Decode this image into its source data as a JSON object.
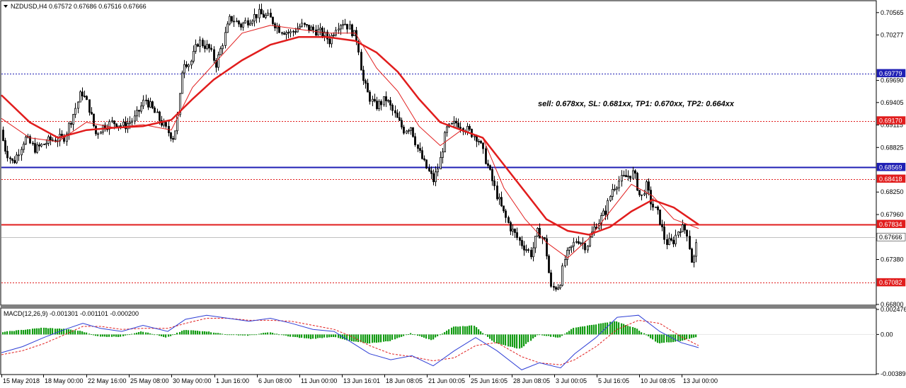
{
  "main_info": "NZDUSD,H4  0.67572 0.67686 0.67516 0.67666",
  "macd_info": "MACD(12,26,9) -0.001301 -0.001101 -0.000200",
  "annotation": "sell: 0.678xx, SL: 0.681xx, TP1: 0.670xx, TP2: 0.664xx",
  "colors": {
    "candle": "#000000",
    "ma_thick": "#e11d1d",
    "ma_thin": "#e11d1d",
    "blue_level": "#1f1fb4",
    "red_level": "#e11d1d",
    "macd_hist": "#129b12",
    "macd_line": "#2f3fd6",
    "macd_signal": "#e11d1d",
    "current_price": "#c0c0c0"
  },
  "chart_data": [
    {
      "type": "candlestick",
      "symbol": "NZDUSD",
      "timeframe": "H4",
      "ylim": [
        0.668,
        0.707
      ],
      "y_ticks": [
        "0.70565",
        "0.70277",
        "0.69690",
        "0.69405",
        "0.69115",
        "0.68825",
        "0.68250",
        "0.67960",
        "0.67380",
        "0.66800"
      ],
      "x_ticks": [
        "15 May 2018",
        "18 May 00:00",
        "22 May 16:00",
        "25 May 08:00",
        "30 May 00:00",
        "1 Jun 16:00",
        "6 Jun 08:00",
        "11 Jun 00:00",
        "13 Jun 16:01",
        "18 Jun 08:05",
        "21 Jun 00:05",
        "25 Jun 16:05",
        "28 Jun 08:05",
        "3 Jul 00:05",
        "5 Jul 16:05",
        "10 Jul 08:05",
        "13 Jul 00:00"
      ],
      "price_path": [
        [
          0,
          0.6905
        ],
        [
          8,
          0.6878
        ],
        [
          18,
          0.6862
        ],
        [
          35,
          0.6895
        ],
        [
          50,
          0.688
        ],
        [
          70,
          0.6892
        ],
        [
          90,
          0.6895
        ],
        [
          105,
          0.693
        ],
        [
          115,
          0.6955
        ],
        [
          125,
          0.6935
        ],
        [
          135,
          0.69
        ],
        [
          145,
          0.691
        ],
        [
          160,
          0.6915
        ],
        [
          175,
          0.691
        ],
        [
          190,
          0.692
        ],
        [
          205,
          0.6945
        ],
        [
          220,
          0.6925
        ],
        [
          235,
          0.6905
        ],
        [
          245,
          0.6895
        ],
        [
          252,
          0.693
        ],
        [
          258,
          0.6995
        ],
        [
          268,
          0.699
        ],
        [
          280,
          0.702
        ],
        [
          295,
          0.701
        ],
        [
          305,
          0.699
        ],
        [
          315,
          0.702
        ],
        [
          325,
          0.705
        ],
        [
          340,
          0.704
        ],
        [
          355,
          0.705
        ],
        [
          365,
          0.7055
        ],
        [
          380,
          0.705
        ],
        [
          395,
          0.7035
        ],
        [
          410,
          0.703
        ],
        [
          425,
          0.704
        ],
        [
          440,
          0.7035
        ],
        [
          455,
          0.703
        ],
        [
          465,
          0.702
        ],
        [
          475,
          0.704
        ],
        [
          485,
          0.7045
        ],
        [
          495,
          0.7035
        ],
        [
          505,
          0.702
        ],
        [
          512,
          0.697
        ],
        [
          520,
          0.695
        ],
        [
          530,
          0.6935
        ],
        [
          545,
          0.6945
        ],
        [
          560,
          0.692
        ],
        [
          570,
          0.6905
        ],
        [
          580,
          0.691
        ],
        [
          590,
          0.688
        ],
        [
          600,
          0.686
        ],
        [
          612,
          0.684
        ],
        [
          620,
          0.686
        ],
        [
          630,
          0.6905
        ],
        [
          645,
          0.6915
        ],
        [
          660,
          0.6905
        ],
        [
          675,
          0.6895
        ],
        [
          690,
          0.6855
        ],
        [
          700,
          0.6825
        ],
        [
          710,
          0.68
        ],
        [
          720,
          0.678
        ],
        [
          735,
          0.676
        ],
        [
          750,
          0.6745
        ],
        [
          760,
          0.6775
        ],
        [
          770,
          0.676
        ],
        [
          778,
          0.67
        ],
        [
          790,
          0.6705
        ],
        [
          798,
          0.674
        ],
        [
          805,
          0.675
        ],
        [
          815,
          0.6765
        ],
        [
          828,
          0.6755
        ],
        [
          840,
          0.678
        ],
        [
          855,
          0.68
        ],
        [
          865,
          0.683
        ],
        [
          875,
          0.684
        ],
        [
          885,
          0.6845
        ],
        [
          895,
          0.685
        ],
        [
          905,
          0.6815
        ],
        [
          912,
          0.6835
        ],
        [
          920,
          0.681
        ],
        [
          930,
          0.6795
        ],
        [
          940,
          0.676
        ],
        [
          950,
          0.676
        ],
        [
          960,
          0.678
        ],
        [
          970,
          0.6775
        ],
        [
          978,
          0.673
        ],
        [
          985,
          0.6765
        ]
      ],
      "moving_averages": {
        "thick": [
          [
            0,
            0.695
          ],
          [
            40,
            0.6915
          ],
          [
            80,
            0.6895
          ],
          [
            120,
            0.6905
          ],
          [
            160,
            0.6908
          ],
          [
            200,
            0.691
          ],
          [
            240,
            0.6918
          ],
          [
            270,
            0.6945
          ],
          [
            300,
            0.697
          ],
          [
            340,
            0.6995
          ],
          [
            380,
            0.7015
          ],
          [
            420,
            0.7025
          ],
          [
            460,
            0.7025
          ],
          [
            500,
            0.702
          ],
          [
            530,
            0.7005
          ],
          [
            560,
            0.698
          ],
          [
            590,
            0.6945
          ],
          [
            620,
            0.6915
          ],
          [
            650,
            0.6905
          ],
          [
            680,
            0.6895
          ],
          [
            710,
            0.686
          ],
          [
            740,
            0.6825
          ],
          [
            770,
            0.679
          ],
          [
            800,
            0.6775
          ],
          [
            830,
            0.677
          ],
          [
            860,
            0.678
          ],
          [
            890,
            0.68
          ],
          [
            920,
            0.6815
          ],
          [
            950,
            0.6805
          ],
          [
            985,
            0.6783
          ]
        ],
        "thin": [
          [
            0,
            0.692
          ],
          [
            40,
            0.6895
          ],
          [
            80,
            0.689
          ],
          [
            120,
            0.6915
          ],
          [
            160,
            0.6908
          ],
          [
            200,
            0.6912
          ],
          [
            240,
            0.6905
          ],
          [
            270,
            0.696
          ],
          [
            300,
            0.699
          ],
          [
            340,
            0.703
          ],
          [
            380,
            0.704
          ],
          [
            420,
            0.7035
          ],
          [
            460,
            0.703
          ],
          [
            500,
            0.703
          ],
          [
            530,
            0.6985
          ],
          [
            560,
            0.6955
          ],
          [
            590,
            0.691
          ],
          [
            620,
            0.6885
          ],
          [
            650,
            0.6905
          ],
          [
            680,
            0.6895
          ],
          [
            710,
            0.683
          ],
          [
            740,
            0.679
          ],
          [
            770,
            0.676
          ],
          [
            800,
            0.674
          ],
          [
            830,
            0.6765
          ],
          [
            860,
            0.68
          ],
          [
            890,
            0.6835
          ],
          [
            920,
            0.682
          ],
          [
            950,
            0.679
          ],
          [
            985,
            0.6778
          ]
        ]
      },
      "levels": [
        {
          "price": 0.69779,
          "label": "0.69779",
          "style": "dotted",
          "color": "#1f1fb4"
        },
        {
          "price": 0.6917,
          "label": "0.69170",
          "style": "dotted",
          "color": "#e11d1d"
        },
        {
          "price": 0.68569,
          "label": "0.68569",
          "style": "solid",
          "color": "#1f1fb4"
        },
        {
          "price": 0.68418,
          "label": "0.68418",
          "style": "dotted",
          "color": "#e11d1d"
        },
        {
          "price": 0.67834,
          "label": "0.67834",
          "style": "solid",
          "color": "#e11d1d"
        },
        {
          "price": 0.67666,
          "label": "0.67666",
          "style": "current",
          "color": "#c0c0c0"
        },
        {
          "price": 0.67082,
          "label": "0.67082",
          "style": "dotted",
          "color": "#e11d1d"
        }
      ]
    },
    {
      "type": "macd",
      "params": "12,26,9",
      "ylim": [
        -0.00389,
        0.002476
      ],
      "y_ticks": [
        "0.002476",
        "0.00",
        "-0.00389"
      ],
      "macd_line": [
        [
          0,
          -0.0018
        ],
        [
          30,
          -0.0012
        ],
        [
          60,
          -0.0003
        ],
        [
          90,
          0.0005
        ],
        [
          115,
          0.0011
        ],
        [
          140,
          0.0006
        ],
        [
          170,
          0.0003
        ],
        [
          200,
          0.0009
        ],
        [
          235,
          0.0003
        ],
        [
          260,
          0.0015
        ],
        [
          290,
          0.0019
        ],
        [
          320,
          0.0016
        ],
        [
          350,
          0.0013
        ],
        [
          380,
          0.0016
        ],
        [
          410,
          0.0011
        ],
        [
          440,
          0.0005
        ],
        [
          470,
          0.0003
        ],
        [
          495,
          -0.0008
        ],
        [
          520,
          -0.0019
        ],
        [
          550,
          -0.0025
        ],
        [
          580,
          -0.0021
        ],
        [
          610,
          -0.0031
        ],
        [
          640,
          -0.0016
        ],
        [
          670,
          -0.0003
        ],
        [
          700,
          -0.0016
        ],
        [
          735,
          -0.0035
        ],
        [
          760,
          -0.0028
        ],
        [
          790,
          -0.0033
        ],
        [
          810,
          -0.0019
        ],
        [
          840,
          -0.0003
        ],
        [
          870,
          0.0017
        ],
        [
          900,
          0.0019
        ],
        [
          930,
          0.0003
        ],
        [
          960,
          -0.0008
        ],
        [
          985,
          -0.0013
        ]
      ],
      "signal_line": [
        [
          0,
          -0.002
        ],
        [
          30,
          -0.0016
        ],
        [
          60,
          -0.0009
        ],
        [
          90,
          0.0
        ],
        [
          115,
          0.0008
        ],
        [
          140,
          0.0008
        ],
        [
          170,
          0.0005
        ],
        [
          200,
          0.0006
        ],
        [
          235,
          0.0006
        ],
        [
          260,
          0.0011
        ],
        [
          290,
          0.0016
        ],
        [
          320,
          0.0016
        ],
        [
          350,
          0.0014
        ],
        [
          380,
          0.0014
        ],
        [
          410,
          0.0013
        ],
        [
          440,
          0.0009
        ],
        [
          470,
          0.0005
        ],
        [
          495,
          -0.0002
        ],
        [
          520,
          -0.0011
        ],
        [
          550,
          -0.0019
        ],
        [
          580,
          -0.0022
        ],
        [
          610,
          -0.0026
        ],
        [
          640,
          -0.0023
        ],
        [
          670,
          -0.0011
        ],
        [
          700,
          -0.0008
        ],
        [
          735,
          -0.0022
        ],
        [
          760,
          -0.0028
        ],
        [
          790,
          -0.003
        ],
        [
          810,
          -0.0025
        ],
        [
          840,
          -0.0012
        ],
        [
          870,
          0.0005
        ],
        [
          900,
          0.0014
        ],
        [
          930,
          0.0011
        ],
        [
          960,
          -0.0002
        ],
        [
          985,
          -0.0011
        ]
      ]
    }
  ]
}
